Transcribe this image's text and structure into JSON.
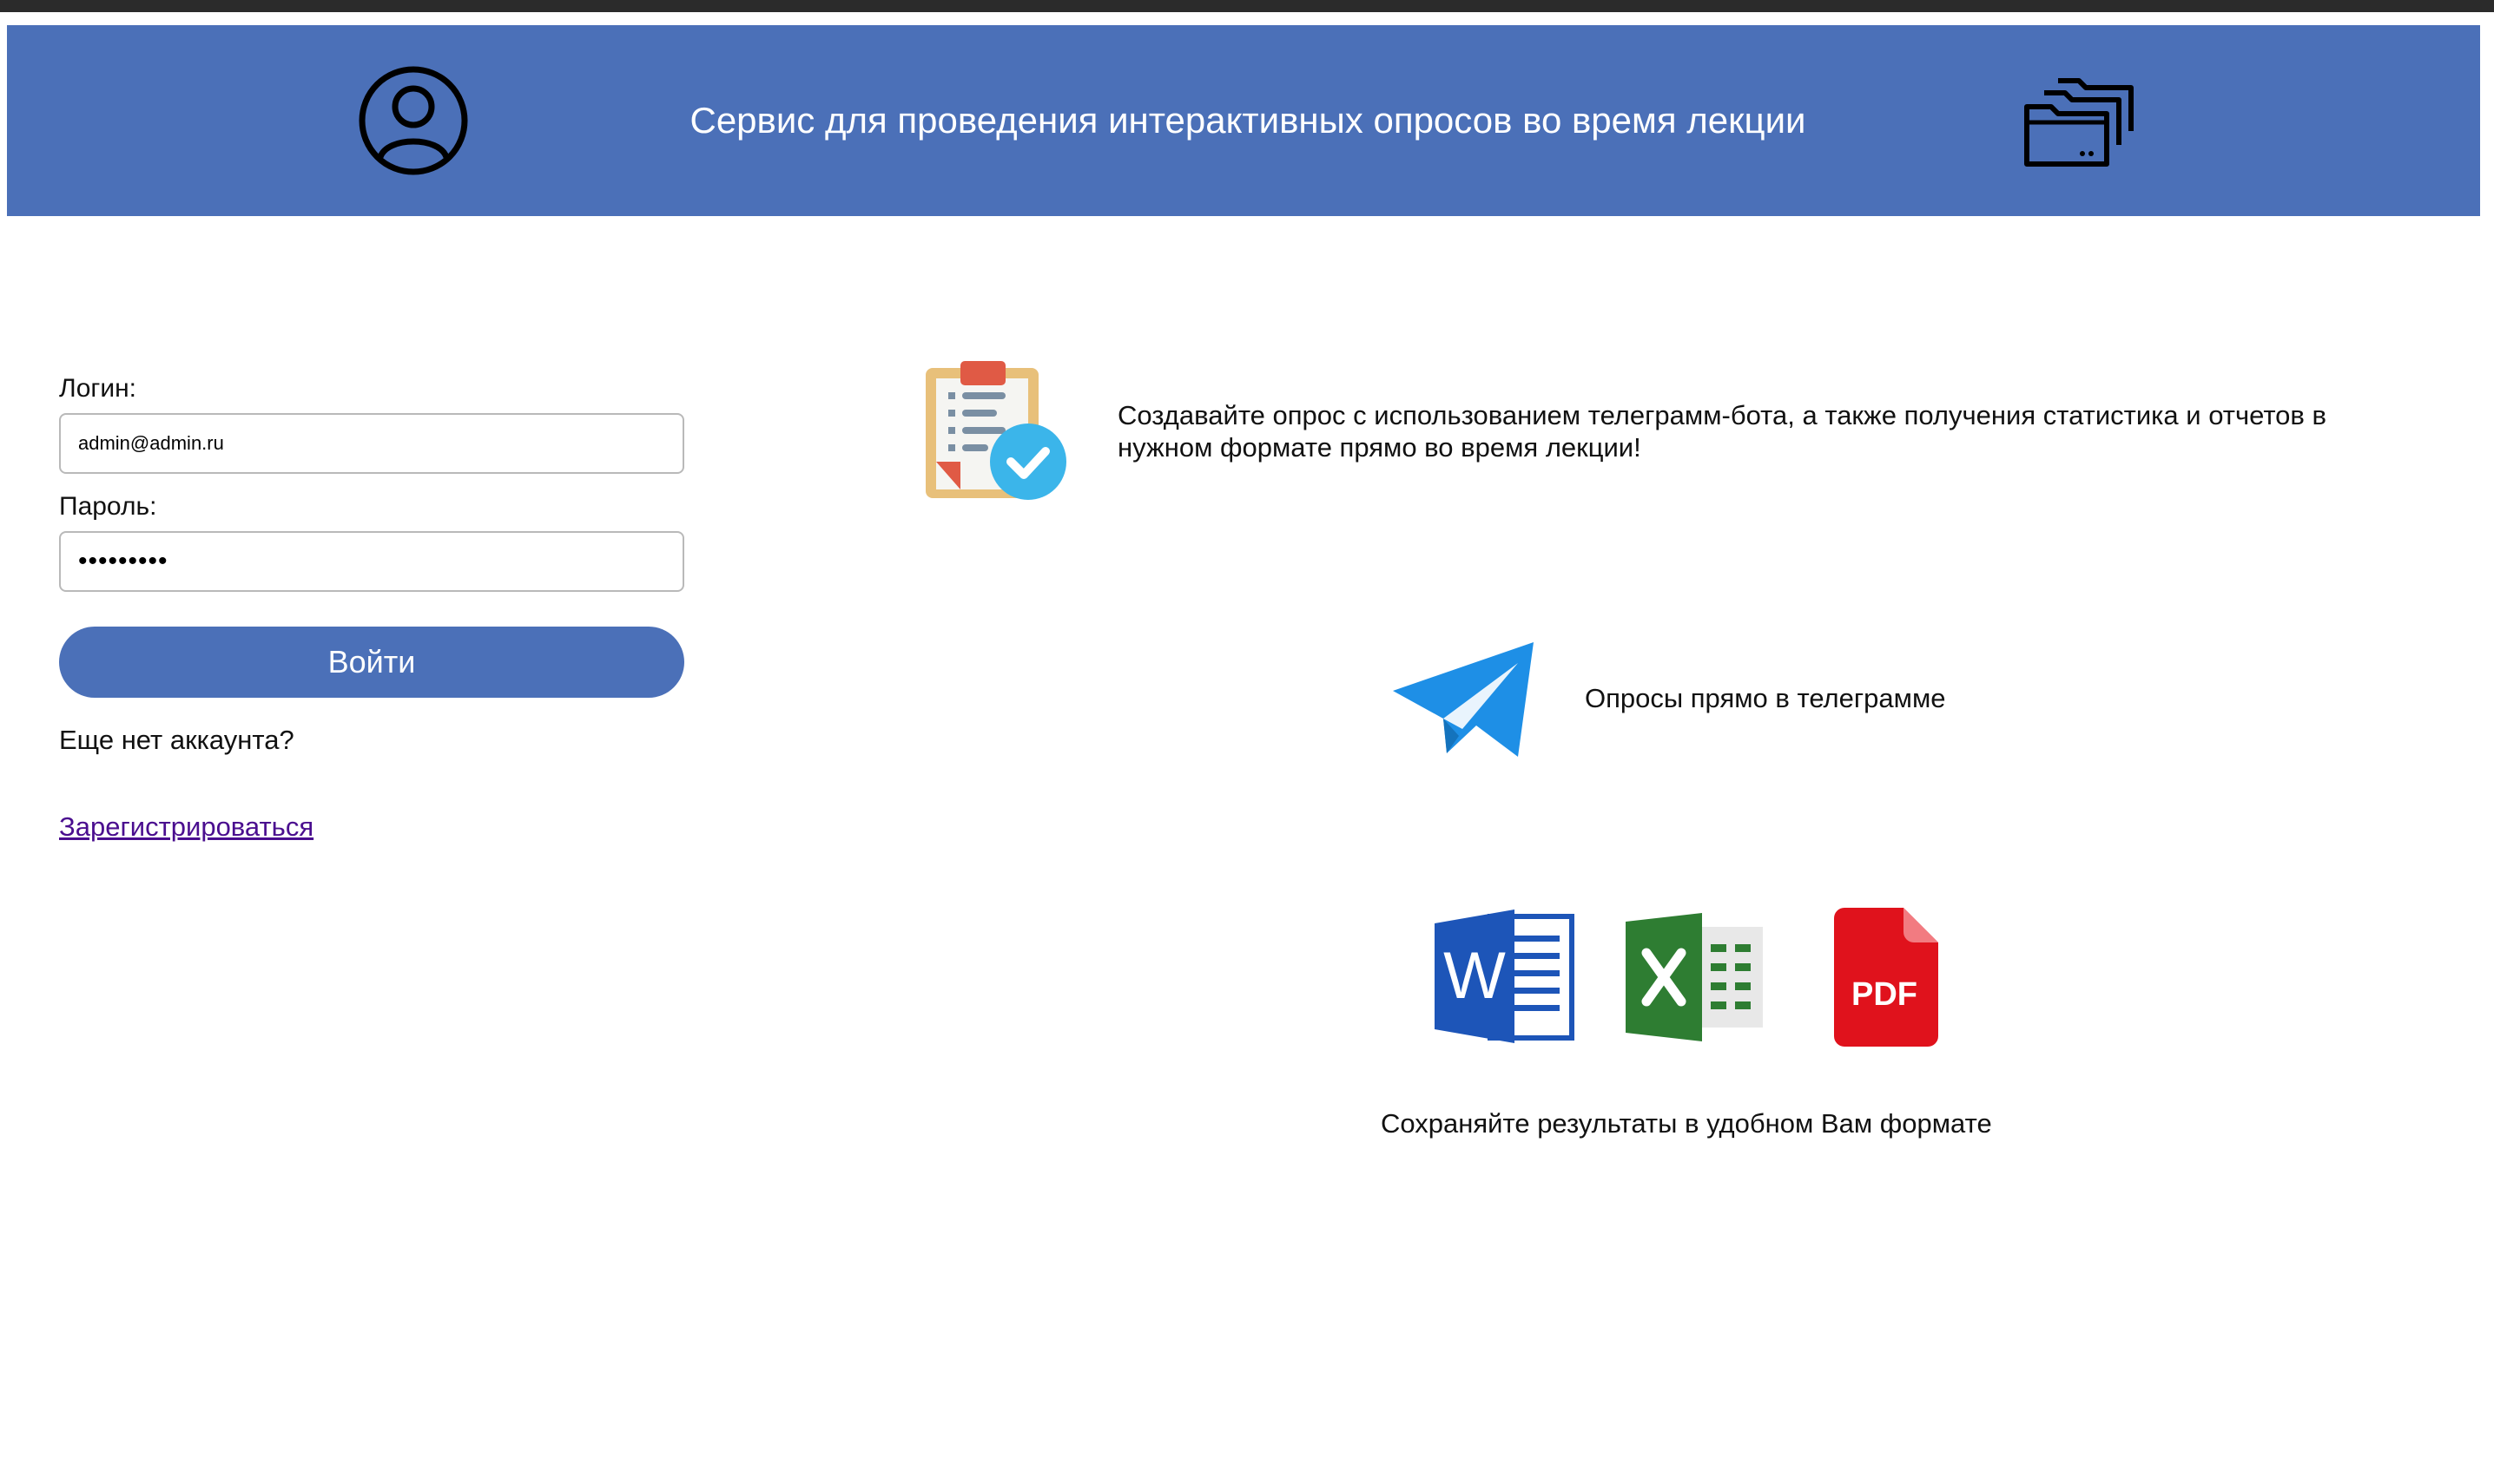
{
  "header": {
    "title": "Сервис для проведения интерактивных опросов во время лекции",
    "user_icon": "user-circle-icon",
    "folders_icon": "folders-icon",
    "background_color": "#4b70b8"
  },
  "login_form": {
    "login_label": "Логин:",
    "login_value": "admin@admin.ru",
    "password_label": "Пароль:",
    "password_masked": "•••••••••",
    "submit_label": "Войти",
    "no_account_text": "Еще нет аккаунта?",
    "register_link": "Зарегистрироваться",
    "accent_color": "#4b70b8"
  },
  "features": {
    "survey": {
      "icon": "clipboard-check-icon",
      "text": "Создавайте опрос с использованием телеграмм-бота, а также получения статистика и отчетов в нужном формате прямо во время лекции!"
    },
    "telegram": {
      "icon": "telegram-plane-icon",
      "text": "Опросы прямо в телеграмме"
    },
    "export": {
      "icons": [
        "word-icon",
        "excel-icon",
        "pdf-icon"
      ],
      "pdf_label": "PDF",
      "text": "Сохраняйте результаты в удобном Вам формате"
    }
  }
}
